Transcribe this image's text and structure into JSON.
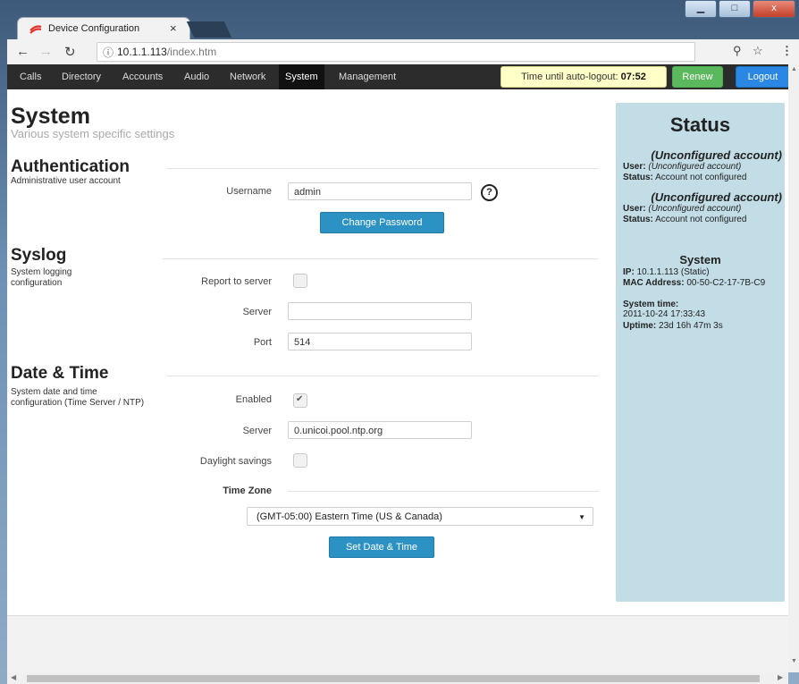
{
  "browser": {
    "tab_title": "Device Configuration",
    "tab_close": "×",
    "url_host": "10.1.1.113",
    "url_path": "/index.htm",
    "window_buttons": [
      "▁",
      "□",
      "x"
    ]
  },
  "nav": {
    "items": [
      "Calls",
      "Directory",
      "Accounts",
      "Audio",
      "Network",
      "System",
      "Management"
    ],
    "active": "System",
    "timer_label": "Time until auto-logout:",
    "timer_value": "07:52",
    "renew_label": "Renew",
    "logout_label": "Logout"
  },
  "page": {
    "title": "System",
    "subtitle": "Various system specific settings"
  },
  "authentication": {
    "heading": "Authentication",
    "description": "Administrative user account",
    "username_label": "Username",
    "username_value": "admin",
    "help": "?",
    "change_password_label": "Change Password"
  },
  "syslog": {
    "heading": "Syslog",
    "description": "System logging configuration",
    "report_label": "Report to server",
    "report_checked": false,
    "server_label": "Server",
    "server_value": "",
    "port_label": "Port",
    "port_value": "514"
  },
  "datetime": {
    "heading": "Date & Time",
    "description": "System date and time configuration (Time Server / NTP)",
    "enabled_label": "Enabled",
    "enabled_checked": true,
    "server_label": "Server",
    "server_value": "0.unicoi.pool.ntp.org",
    "daylight_label": "Daylight savings",
    "daylight_checked": false,
    "timezone_heading": "Time Zone",
    "timezone_value": "(GMT-05:00) Eastern Time (US & Canada)",
    "set_button_label": "Set Date & Time"
  },
  "status": {
    "heading": "Status",
    "accounts": [
      {
        "name": "(Unconfigured account)",
        "user_label": "User:",
        "user_value": "(Unconfigured account)",
        "status_label": "Status:",
        "status_value": "Account not configured"
      },
      {
        "name": "(Unconfigured account)",
        "user_label": "User:",
        "user_value": "(Unconfigured account)",
        "status_label": "Status:",
        "status_value": "Account not configured"
      }
    ],
    "system": {
      "heading": "System",
      "ip_label": "IP:",
      "ip_value": "10.1.1.113 (Static)",
      "mac_label": "MAC Address:",
      "mac_value": "00-50-C2-17-7B-C9",
      "time_label": "System time:",
      "time_value": "2011-10-24 17:33:43",
      "uptime_label": "Uptime:",
      "uptime_value": "23d 16h 47m 3s"
    }
  }
}
